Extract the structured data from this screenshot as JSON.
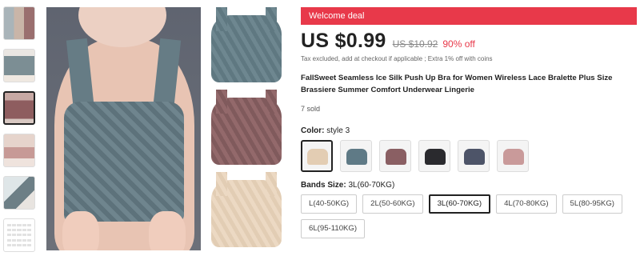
{
  "thumbnails": [
    "thumb-1",
    "thumb-2",
    "thumb-3",
    "thumb-4",
    "thumb-5",
    "thumb-6"
  ],
  "active_thumbnail": 2,
  "deal_banner": "Welcome deal",
  "price": {
    "current": "US $0.99",
    "original": "US $10.92",
    "discount": "90% off",
    "note": "Tax excluded, add at checkout if applicable ; Extra 1% off with coins"
  },
  "product": {
    "title": "FallSweet Seamless Ice Silk Push Up Bra for Women Wireless Lace Bralette Plus Size Brassiere Summer Comfort Underwear Lingerie",
    "sold": "7 sold"
  },
  "color_option": {
    "label": "Color:",
    "selected": "style 3",
    "swatches": [
      {
        "color": "#e3cdb3",
        "selected": true
      },
      {
        "color": "#5f7a86",
        "selected": false
      },
      {
        "color": "#8a5f63",
        "selected": false
      },
      {
        "color": "#2a2a2e",
        "selected": false
      },
      {
        "color": "#4d5468",
        "selected": false
      },
      {
        "color": "#c99a9a",
        "selected": false
      }
    ]
  },
  "size_option": {
    "label": "Bands Size:",
    "selected": "3L(60-70KG)",
    "sizes": [
      {
        "label": "L(40-50KG)",
        "selected": false
      },
      {
        "label": "2L(50-60KG)",
        "selected": false
      },
      {
        "label": "3L(60-70KG)",
        "selected": true
      },
      {
        "label": "4L(70-80KG)",
        "selected": false
      },
      {
        "label": "5L(80-95KG)",
        "selected": false
      },
      {
        "label": "6L(95-110KG)",
        "selected": false
      }
    ]
  },
  "colors": {
    "accent": "#e8394a",
    "text": "#222222"
  }
}
